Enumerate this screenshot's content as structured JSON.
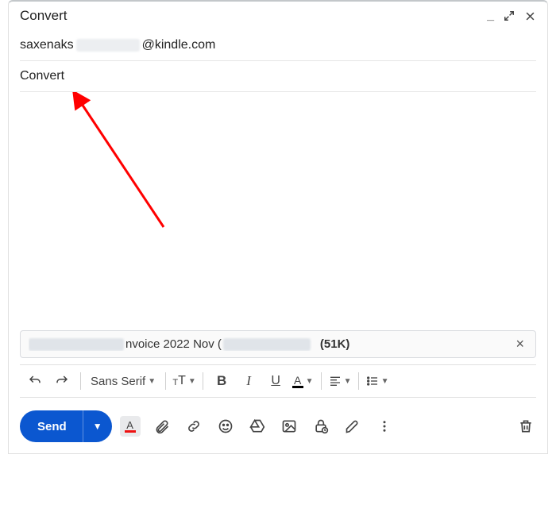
{
  "window": {
    "title": "Convert"
  },
  "fields": {
    "to_prefix": "saxenaks",
    "to_suffix": "@kindle.com",
    "subject": "Convert"
  },
  "attachment": {
    "mid": "nvoice 2022 Nov (",
    "size": "(51K)"
  },
  "format": {
    "font": "Sans Serif"
  },
  "actions": {
    "send": "Send"
  }
}
